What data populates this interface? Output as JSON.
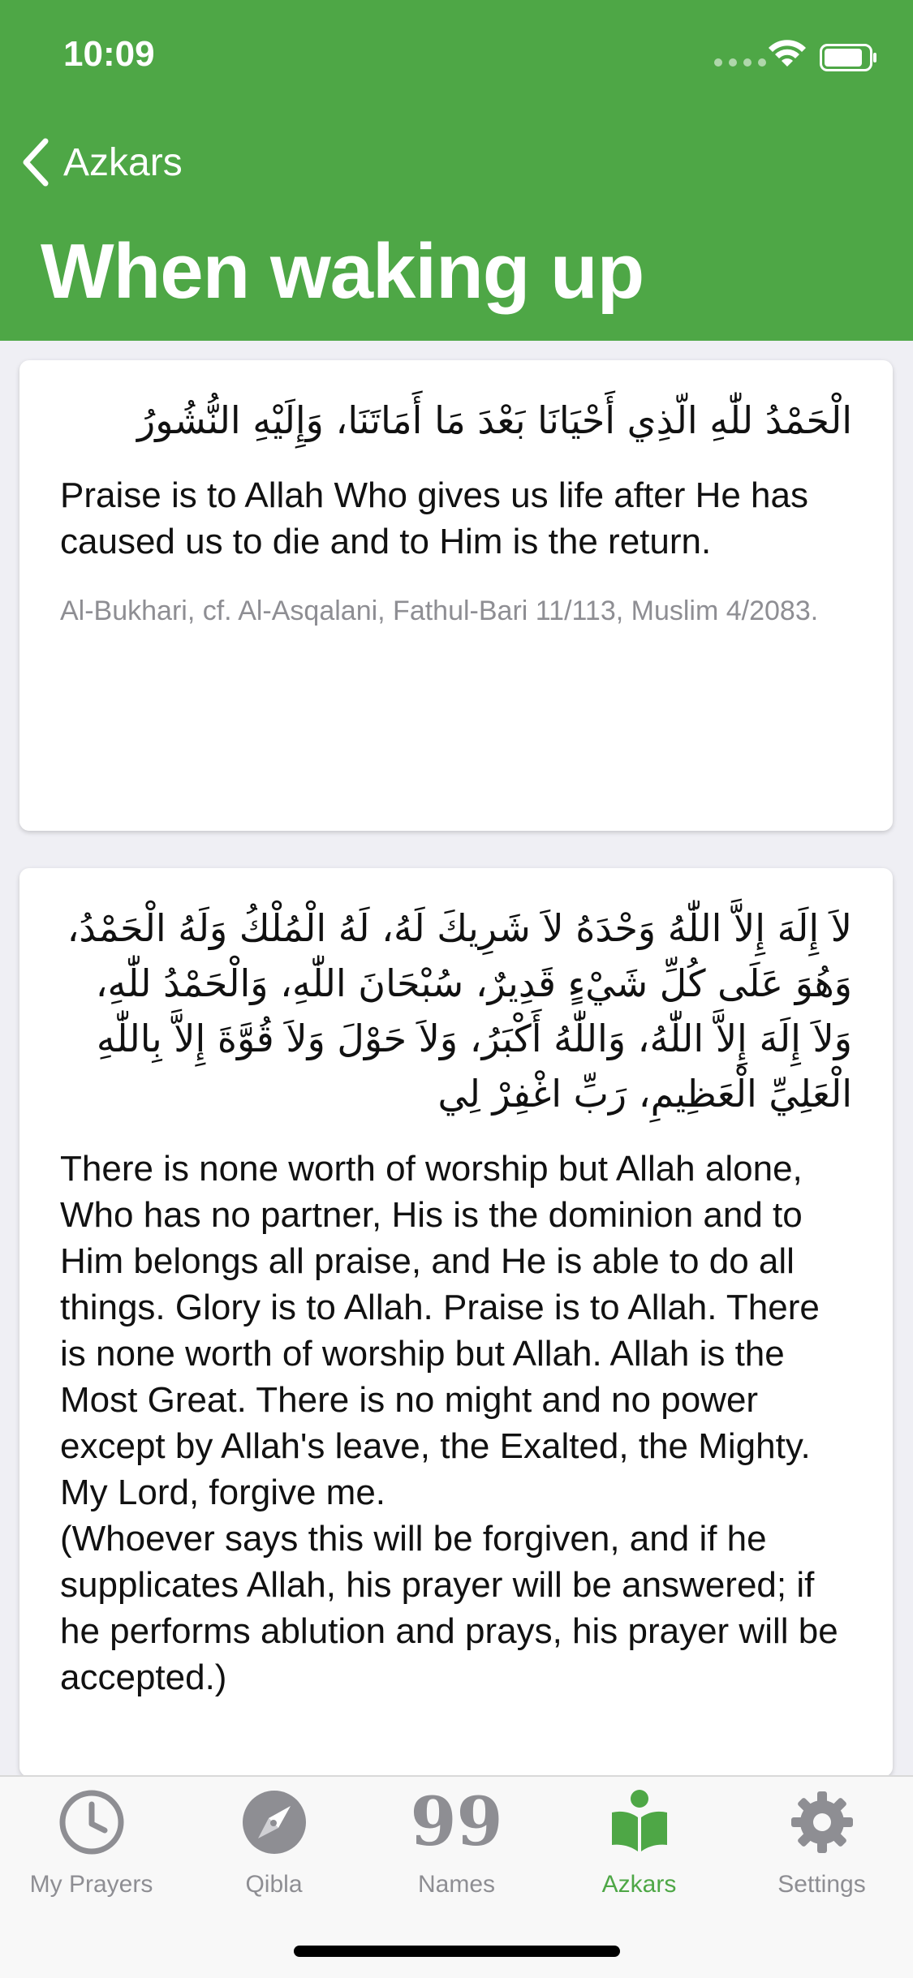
{
  "status_bar": {
    "time": "10:09"
  },
  "nav": {
    "back_label": "Azkars",
    "title": "When waking up"
  },
  "cards": [
    {
      "arabic": "الْحَمْدُ للّٰهِ الّذِي أَحْيَانَا بَعْدَ مَا أَمَاتَنَا، وَإِلَيْهِ النُّشُورُ",
      "translation": "Praise is to Allah Who gives us life after He has caused us to die and to Him is the return.",
      "reference": "Al-Bukhari, cf. Al-Asqalani, Fathul-Bari 11/113, Muslim 4/2083."
    },
    {
      "arabic": "لاَ إِلَهَ إِلاَّ اللّٰهُ وَحْدَهُ لاَ شَرِيكَ لَهُ، لَهُ الْمُلْكُ وَلَهُ الْحَمْدُ، وَهُوَ عَلَى كُلِّ شَيْءٍ قَدِيرٌ، سُبْحَانَ اللّٰهِ، وَالْحَمْدُ للّٰهِ، وَلاَ إِلَهَ إِلاَّ اللّٰهُ، وَاللّٰهُ أَكْبَرُ، وَلاَ حَوْلَ وَلاَ قُوَّةَ إِلاَّ بِاللّٰهِ الْعَلِيِّ الْعَظِيمِ، رَبِّ اغْفِرْ لِي",
      "translation": "There is none worth of worship but Allah alone, Who has no partner, His is the dominion and to Him belongs all praise, and He is able to do all things. Glory is to Allah. Praise is to Allah. There is none worth of worship but Allah. Allah is the Most Great. There is no might and no power except by Allah's leave, the Exalted, the Mighty. My Lord, forgive me.\n(Whoever says this will be forgiven, and if he supplicates Allah, his prayer will be answered; if he performs ablution and prays, his prayer will be accepted.)"
    }
  ],
  "tabs": [
    {
      "label": "My Prayers",
      "icon": "clock-icon"
    },
    {
      "label": "Qibla",
      "icon": "compass-icon"
    },
    {
      "label": "Names",
      "icon": "99-icon",
      "glyph": "99"
    },
    {
      "label": "Azkars",
      "icon": "reading-person-icon",
      "active": true
    },
    {
      "label": "Settings",
      "icon": "gear-icon"
    }
  ],
  "colors": {
    "accent": "#4ea746",
    "inactive": "#8e8e93"
  }
}
